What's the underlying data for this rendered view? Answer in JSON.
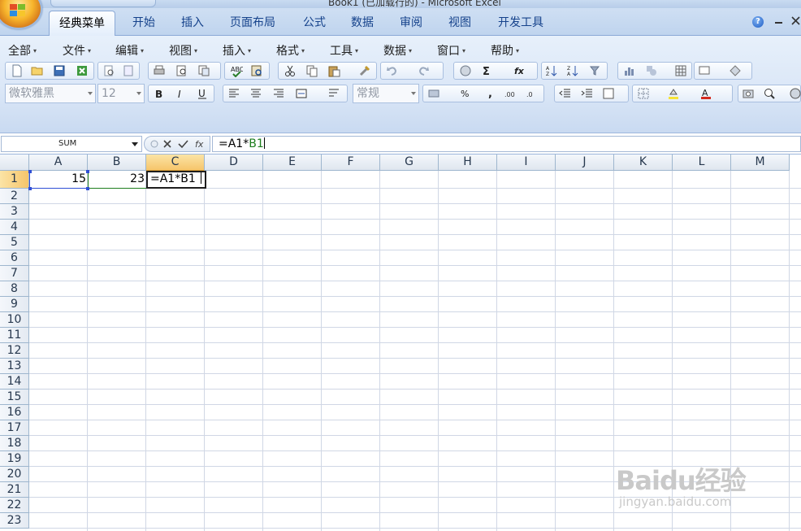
{
  "window": {
    "title": "Book1 (已加载行的) - Microsoft Excel"
  },
  "tabs": [
    "经典菜单",
    "开始",
    "插入",
    "页面布局",
    "公式",
    "数据",
    "审阅",
    "视图",
    "开发工具"
  ],
  "active_tab": "经典菜单",
  "menus": [
    "全部",
    "文件",
    "编辑",
    "视图",
    "插入",
    "格式",
    "工具",
    "数据",
    "窗口",
    "帮助"
  ],
  "font_name": "微软雅黑",
  "font_size": "12",
  "number_format": "常规",
  "formula_bar": {
    "name_box": "SUM",
    "formula_prefix": "=A1*",
    "formula_ref": "B1"
  },
  "columns": [
    "A",
    "B",
    "C",
    "D",
    "E",
    "F",
    "G",
    "H",
    "I",
    "J",
    "K",
    "L",
    "M"
  ],
  "rows": [
    "1",
    "2",
    "3",
    "4",
    "5",
    "6",
    "7",
    "8",
    "9",
    "10",
    "11",
    "12",
    "13",
    "14",
    "15",
    "16",
    "17",
    "18",
    "19",
    "20",
    "21",
    "22",
    "23"
  ],
  "cells": {
    "A1": "15",
    "B1": "23",
    "C1": "=A1*B1"
  },
  "active_cell": "C1",
  "watermark": {
    "brand": "Baidu经验",
    "url": "jingyan.baidu.com"
  },
  "colors": {
    "ref_green": "#1e7d1e",
    "ref_blue": "#2f4fd6",
    "selection": "#f6c56b"
  }
}
